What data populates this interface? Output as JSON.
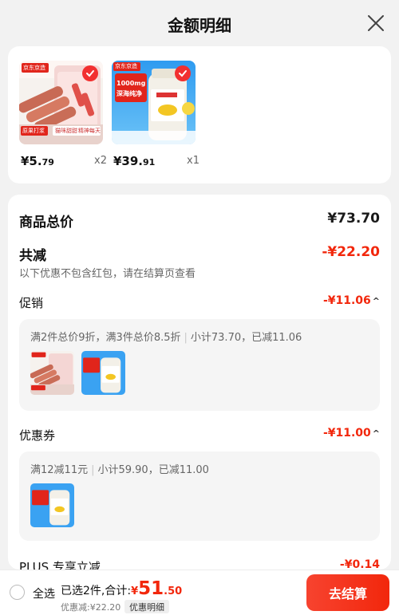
{
  "header": {
    "title": "金额明细"
  },
  "products": [
    {
      "price_int": "¥5.",
      "price_dec": "79",
      "qty": "x2",
      "brand": "京东京造",
      "tags": [
        "原果打浆",
        "猫咪甜甜",
        "精神每天"
      ]
    },
    {
      "price_int": "¥39.",
      "price_dec": "91",
      "qty": "x1",
      "brand": "京东京造",
      "tags": [
        "1000mg",
        "深海纯净"
      ]
    }
  ],
  "summary": {
    "goods_total_label": "商品总价",
    "goods_total_value": "¥73.70",
    "reduced_label": "共减",
    "reduced_value": "-¥22.20",
    "note": "以下优惠不包含红包，请在结算页查看"
  },
  "promotion": {
    "label": "促销",
    "value": "-¥11.06",
    "desc_main": "满2件总价9折，满3件总价8.5折",
    "desc_sub": "小计73.70，已减11.06"
  },
  "coupon": {
    "label": "优惠券",
    "value": "-¥11.00",
    "desc_main": "满12减11元",
    "desc_sub": "小计59.90，已减11.00"
  },
  "plus": {
    "label": "PLUS 专享立减",
    "value": "-¥0.14"
  },
  "bottom": {
    "select_all": "全选",
    "selected": "已选2件,合计:",
    "yen": "¥",
    "total_int": "51",
    "total_dec": ".50",
    "discount": "优惠减:¥22.20",
    "detail": "优惠明细",
    "checkout": "去结算"
  },
  "colors": {
    "accent": "#f2270c"
  }
}
